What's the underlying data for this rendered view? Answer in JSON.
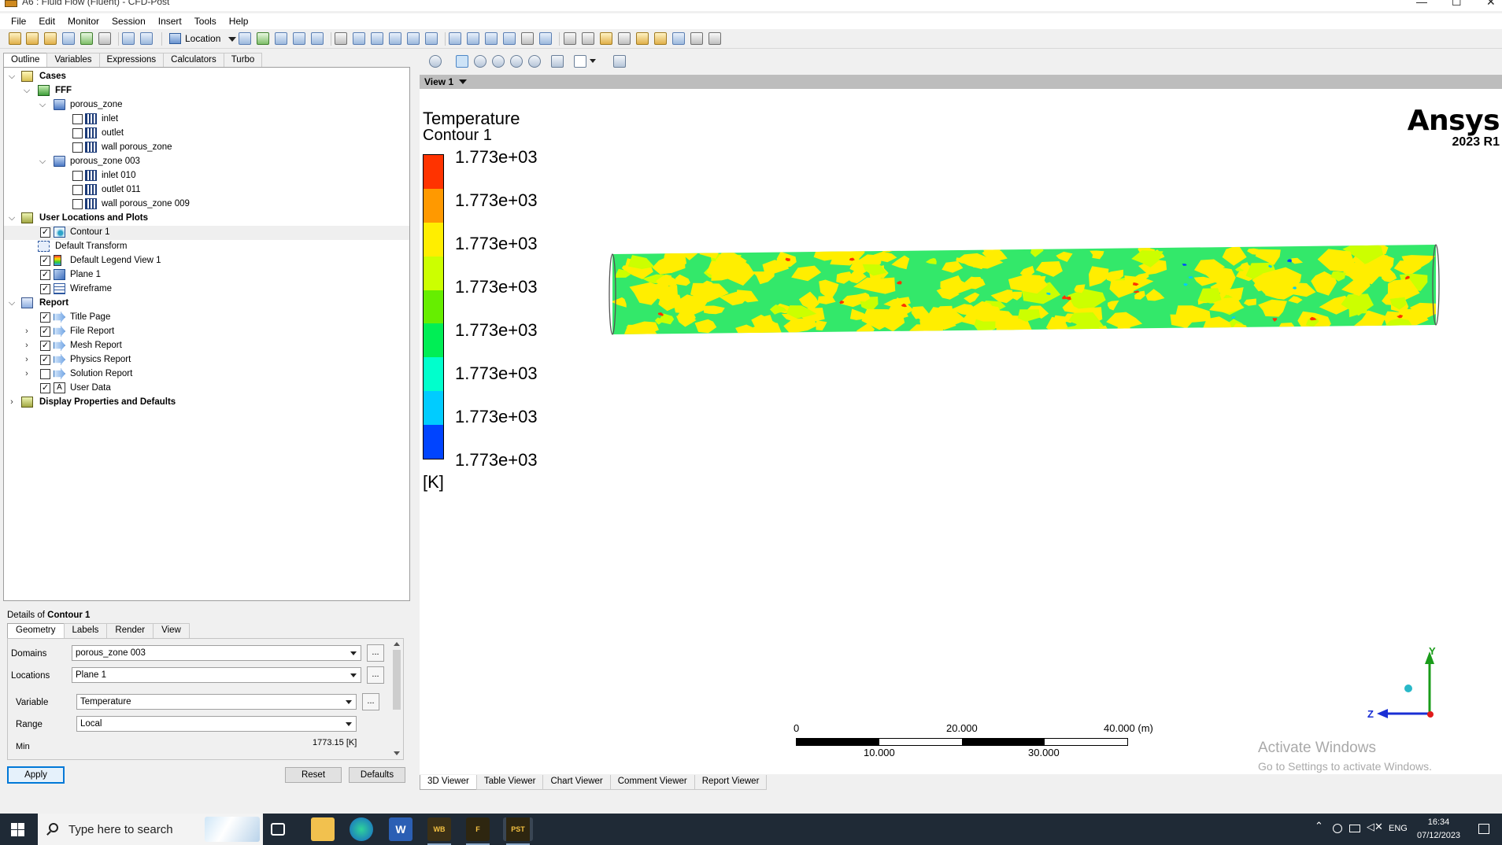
{
  "window": {
    "title": "A6 : Fluid Flow (Fluent) - CFD-Post",
    "controls": [
      "—",
      "☐",
      "✕"
    ]
  },
  "menu": [
    "File",
    "Edit",
    "Monitor",
    "Session",
    "Insert",
    "Tools",
    "Help"
  ],
  "toolbar": {
    "location_label": "Location"
  },
  "outline_tabs": [
    "Outline",
    "Variables",
    "Expressions",
    "Calculators",
    "Turbo"
  ],
  "tree": {
    "cases": "Cases",
    "fff": "FFF",
    "porous_zone": "porous_zone",
    "inlet": "inlet",
    "outlet": "outlet",
    "wall_porous_zone": "wall porous_zone",
    "porous_zone_003": "porous_zone 003",
    "inlet_010": "inlet 010",
    "outlet_011": "outlet 011",
    "wall_porous_zone_009": "wall porous_zone 009",
    "user_locations": "User Locations and Plots",
    "contour_1": "Contour 1",
    "default_transform": "Default Transform",
    "default_legend": "Default Legend View 1",
    "plane_1": "Plane 1",
    "wireframe": "Wireframe",
    "report": "Report",
    "title_page": "Title Page",
    "file_report": "File Report",
    "mesh_report": "Mesh Report",
    "physics_report": "Physics Report",
    "solution_report": "Solution Report",
    "user_data": "User Data",
    "display_props": "Display Properties and Defaults"
  },
  "details": {
    "title_prefix": "Details of",
    "title_object": "Contour 1",
    "tabs": [
      "Geometry",
      "Labels",
      "Render",
      "View"
    ],
    "domains_label": "Domains",
    "domains_value": "porous_zone 003",
    "locations_label": "Locations",
    "locations_value": "Plane 1",
    "variable_label": "Variable",
    "variable_value": "Temperature",
    "range_label": "Range",
    "range_value": "Local",
    "min_label": "Min",
    "min_value": "1773.15 [K]",
    "dots": "...",
    "apply": "Apply",
    "reset": "Reset",
    "defaults": "Defaults"
  },
  "viewer": {
    "view_name": "View 1",
    "legend_title": "Temperature",
    "legend_subtitle": "Contour 1",
    "legend_values": [
      "1.773e+03",
      "1.773e+03",
      "1.773e+03",
      "1.773e+03",
      "1.773e+03",
      "1.773e+03",
      "1.773e+03",
      "1.773e+03"
    ],
    "legend_unit": "[K]",
    "legend_colors": [
      "#ff3300",
      "#ff9900",
      "#ffee00",
      "#ccff00",
      "#66ee00",
      "#00ee55",
      "#00ffcc",
      "#00ccff",
      "#0044ff"
    ],
    "brand_name": "Ansys",
    "brand_version": "2023 R1",
    "scale_top": [
      "0",
      "20.000",
      "40.000 (m)"
    ],
    "scale_bottom": [
      "10.000",
      "30.000"
    ],
    "axis_y": "Y",
    "axis_z": "Z",
    "activate_1": "Activate Windows",
    "activate_2": "Go to Settings to activate Windows.",
    "bottom_tabs": [
      "3D Viewer",
      "Table Viewer",
      "Chart Viewer",
      "Comment Viewer",
      "Report Viewer"
    ]
  },
  "taskbar": {
    "search_placeholder": "Type here to search",
    "apps": [
      "WB",
      "F",
      "PST"
    ],
    "lang": "ENG",
    "time": "16:34",
    "date": "07/12/2023"
  }
}
